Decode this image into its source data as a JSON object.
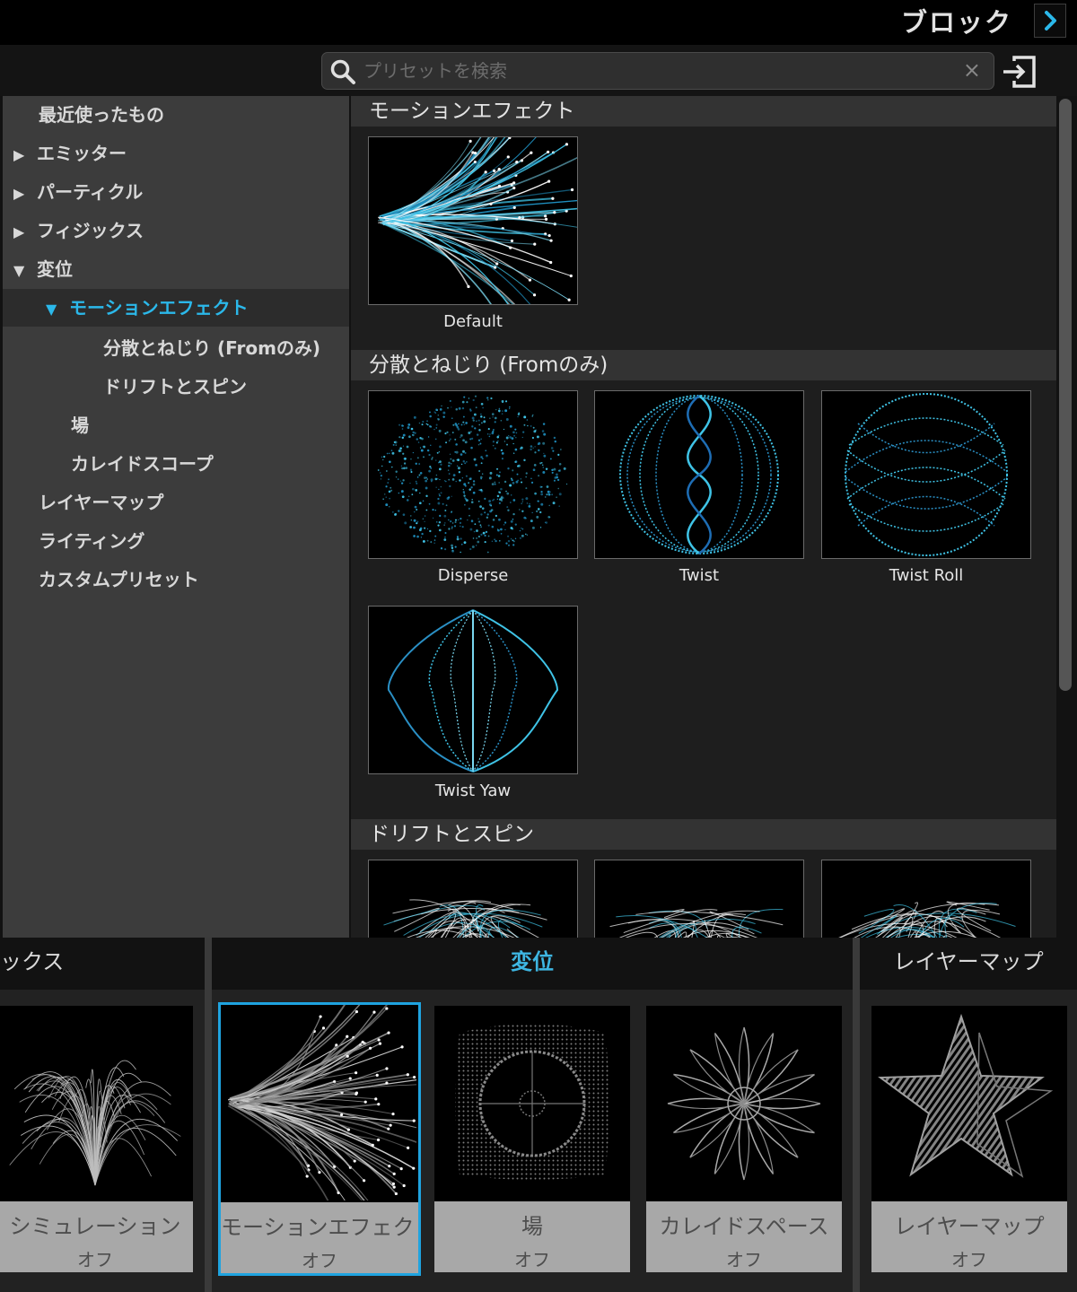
{
  "top_bar": {
    "title": "ブロック",
    "arrow_icon": "chevron-right-icon"
  },
  "search": {
    "placeholder": "プリセットを検索",
    "value": "",
    "clear": "×"
  },
  "sidebar": {
    "items": [
      {
        "label": "最近使ったもの",
        "marker": "",
        "level": 0
      },
      {
        "label": "エミッター",
        "marker": "▶",
        "level": 0
      },
      {
        "label": "パーティクル",
        "marker": "▶",
        "level": 0
      },
      {
        "label": "フィジックス",
        "marker": "▶",
        "level": 0
      },
      {
        "label": "変位",
        "marker": "▼",
        "level": 0
      },
      {
        "label": "モーションエフェクト",
        "marker": "▼",
        "level": 1,
        "active": true
      },
      {
        "label": "分散とねじり (Fromのみ)",
        "marker": "",
        "level": 2
      },
      {
        "label": "ドリフトとスピン",
        "marker": "",
        "level": 2
      },
      {
        "label": "場",
        "marker": "",
        "level": 1
      },
      {
        "label": "カレイドスコープ",
        "marker": "",
        "level": 1
      },
      {
        "label": "レイヤーマップ",
        "marker": "",
        "level": 0
      },
      {
        "label": "ライティング",
        "marker": "",
        "level": 0
      },
      {
        "label": "カスタムプリセット",
        "marker": "",
        "level": 0
      }
    ]
  },
  "panel": {
    "sections": [
      {
        "title": "モーションエフェクト",
        "presets": [
          {
            "label": "Default"
          }
        ]
      },
      {
        "title": "分散とねじり (Fromのみ)",
        "presets": [
          {
            "label": "Disperse"
          },
          {
            "label": "Twist"
          },
          {
            "label": "Twist Roll"
          },
          {
            "label": "Twist Yaw"
          }
        ]
      },
      {
        "title": "ドリフトとスピン",
        "presets": []
      }
    ]
  },
  "bottom": {
    "categories": [
      {
        "label": "ックス"
      },
      {
        "label": "変位"
      },
      {
        "label": "レイヤーマップ"
      }
    ],
    "cards": [
      {
        "name": "シミュレーション",
        "state": "オフ"
      },
      {
        "name": "モーションエフェクト",
        "state": "オフ",
        "selected": true
      },
      {
        "name": "場",
        "state": "オフ"
      },
      {
        "name": "カレイドスペース",
        "state": "オフ"
      },
      {
        "name": "レイヤーマップ",
        "state": "オフ"
      }
    ]
  },
  "colors": {
    "accent": "#2bb8ea",
    "selection": "#1fa3df",
    "particle_cyan": "#3fc3e6"
  }
}
